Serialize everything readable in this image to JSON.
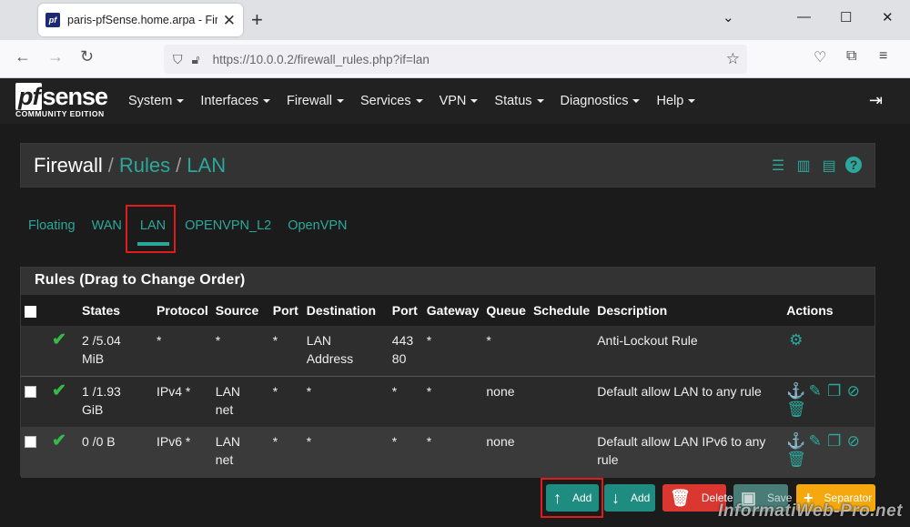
{
  "browser": {
    "tab_title": "paris-pfSense.home.arpa - Firew",
    "favicon_text": "pf",
    "url": "https://10.0.0.2/firewall_rules.php?if=lan"
  },
  "pfsense": {
    "logo_main": "sense",
    "logo_pf": "pf",
    "logo_sub": "COMMUNITY EDITION",
    "menu": [
      "System",
      "Interfaces",
      "Firewall",
      "Services",
      "VPN",
      "Status",
      "Diagnostics",
      "Help"
    ]
  },
  "breadcrumb": {
    "part1": "Firewall",
    "sep": "/",
    "part2": "Rules",
    "part3": "LAN"
  },
  "tabs": [
    "Floating",
    "WAN",
    "LAN",
    "OPENVPN_L2",
    "OpenVPN"
  ],
  "rules": {
    "heading": "Rules (Drag to Change Order)",
    "columns": [
      "States",
      "Protocol",
      "Source",
      "Port",
      "Destination",
      "Port",
      "Gateway",
      "Queue",
      "Schedule",
      "Description",
      "Actions"
    ],
    "rows": [
      {
        "states_1": "2 /5.04",
        "states_2": "MiB",
        "protocol": "*",
        "source_1": "*",
        "source_2": "",
        "sport": "*",
        "dest_1": "LAN",
        "dest_2": "Address",
        "dport_1": "443",
        "dport_2": "80",
        "gateway": "*",
        "queue": "*",
        "schedule": "",
        "desc_1": "Anti-Lockout Rule",
        "desc_2": ""
      },
      {
        "states_1": "1 /1.93",
        "states_2": "GiB",
        "protocol": "IPv4 *",
        "source_1": "LAN",
        "source_2": "net",
        "sport": "*",
        "dest_1": "*",
        "dest_2": "",
        "dport_1": "*",
        "dport_2": "",
        "gateway": "*",
        "queue": "none",
        "schedule": "",
        "desc_1": "Default allow LAN to any rule",
        "desc_2": ""
      },
      {
        "states_1": "0 /0 B",
        "states_2": "",
        "protocol": "IPv6 *",
        "source_1": "LAN",
        "source_2": "net",
        "sport": "*",
        "dest_1": "*",
        "dest_2": "",
        "dport_1": "*",
        "dport_2": "",
        "gateway": "*",
        "queue": "none",
        "schedule": "",
        "desc_1": "Default allow LAN IPv6 to any",
        "desc_2": "rule"
      }
    ]
  },
  "buttons": {
    "add_top": "Add",
    "add_bottom": "Add",
    "delete": "Delete",
    "save": "Save",
    "separator": "Separator"
  },
  "watermark": "InformatiWeb-Pro.net",
  "colors": {
    "accent": "#2ba89b",
    "check": "#37b94a",
    "delete": "#d9372f",
    "separator": "#f4a80e",
    "highlight": "#e01b1b"
  }
}
